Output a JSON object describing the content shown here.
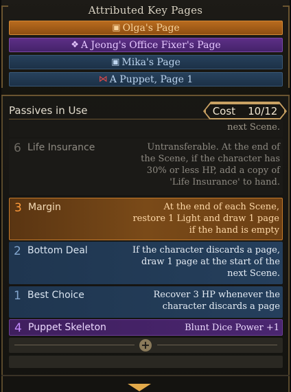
{
  "key_pages": {
    "title": "Attributed Key Pages",
    "items": [
      {
        "label": "Olga's Page",
        "icon": "mask-icon",
        "glyph": "▣"
      },
      {
        "label": "A Jeong's Office Fixer's Page",
        "icon": "ornament-icon",
        "glyph": "❖"
      },
      {
        "label": "Mika's Page",
        "icon": "mask-icon",
        "glyph": "▣"
      },
      {
        "label": "A Puppet, Page 1",
        "icon": "puppet-bow-icon",
        "glyph": "⋈"
      }
    ]
  },
  "passives": {
    "header": "Passives in Use",
    "cost_label": "Cost",
    "cost_value": "10/12",
    "prev_fragment": "next Scene.",
    "items": [
      {
        "cost": "6",
        "name": "Life Insurance",
        "desc": "Untransferable. At the end of the Scene, if the character has 30% or less HP, add a copy of 'Life Insurance' to hand.",
        "state": "disabled"
      },
      {
        "cost": "3",
        "name": "Margin",
        "desc": "At the end of each Scene, restore 1 Light and draw 1 page if the hand is empty",
        "state": "selected"
      },
      {
        "cost": "2",
        "name": "Bottom Deal",
        "desc": "If the character discards a page, draw 1 page at the start of the next Scene.",
        "state": "active"
      },
      {
        "cost": "1",
        "name": "Best Choice",
        "desc": "Recover 3 HP whenever the character discards a page",
        "state": "active"
      },
      {
        "cost": "4",
        "name": "Puppet Skeleton",
        "desc": "Blunt Dice Power +1",
        "state": "purple"
      }
    ]
  },
  "colors": {
    "accent_gold": "#c9a163",
    "orange": "#b86b1e",
    "purple": "#5c2f86",
    "blue": "#27415c"
  }
}
